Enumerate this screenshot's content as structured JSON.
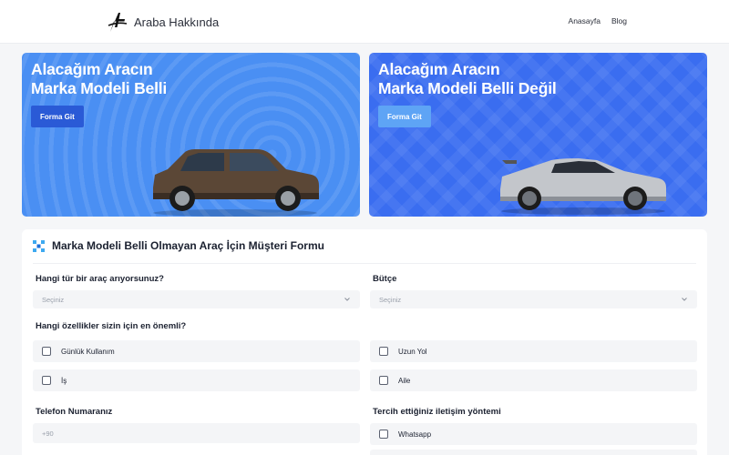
{
  "header": {
    "logo_text": "Araba Hakkında",
    "nav": [
      "Anasayfa",
      "Blog"
    ]
  },
  "hero": {
    "left": {
      "title_line1": "Alacağım Aracın",
      "title_line2": "Marka Modeli Belli",
      "button": "Forma Git",
      "bg_color": "#4a8ff3"
    },
    "right": {
      "title_line1": "Alacağım Aracın",
      "title_line2": "Marka Modeli Belli Değil",
      "button": "Forma Git",
      "bg_color": "#3a6df0"
    }
  },
  "form": {
    "title": "Marka Modeli Belli Olmayan Araç İçin Müşteri Formu",
    "q_vehicle_type": "Hangi tür bir araç arıyorsunuz?",
    "q_vehicle_type_value": "Seçiniz",
    "q_budget": "Bütçe",
    "q_budget_value": "Seçiniz",
    "q_features": "Hangi özellikler sizin için en önemli?",
    "features": [
      "Günlük Kullanım",
      "Uzun Yol",
      "İş",
      "Aile"
    ],
    "q_phone": "Telefon Numaranız",
    "phone_placeholder": "+90",
    "q_contact": "Tercih ettiğiniz iletişim yöntemi",
    "contact_options": [
      "Whatsapp"
    ]
  },
  "colors": {
    "accent": "#2a5ad6",
    "page_bg": "#f5f6f8"
  },
  "icons": {
    "logo": "stylized-a-logo-icon",
    "form": "grid-dots-icon",
    "select": "chevron-down-icon"
  }
}
